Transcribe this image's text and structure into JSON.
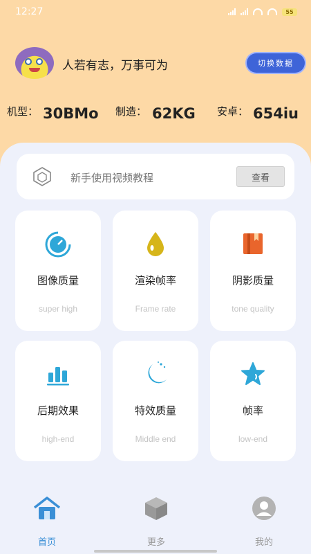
{
  "status_bar": {
    "time": "12:27",
    "battery": "55",
    "icons": [
      "signal-icon",
      "signal-icon",
      "wifi-icon",
      "wifi-icon",
      "battery-icon"
    ]
  },
  "header": {
    "avatar_icon": "spongebob-avatar",
    "motto": "人若有志，万事可为",
    "switch_label": "切换数据"
  },
  "specs": [
    {
      "label": "机型：",
      "value": "30BMo"
    },
    {
      "label": "制造：",
      "value": "62KG"
    },
    {
      "label": "安卓：",
      "value": "654iu"
    }
  ],
  "tutorial": {
    "icon": "hexagon-cube-icon",
    "text": "新手使用视频教程",
    "button": "查看"
  },
  "features": [
    {
      "title": "图像质量",
      "subtitle": "super high",
      "icon": "gauge-icon",
      "color": "#2ea7d8"
    },
    {
      "title": "渲染帧率",
      "subtitle": "Frame rate",
      "icon": "drop-icon",
      "color": "#d6b51a"
    },
    {
      "title": "阴影质量",
      "subtitle": "tone quality",
      "icon": "book-icon",
      "color": "#e9652c"
    },
    {
      "title": "后期效果",
      "subtitle": "high-end",
      "icon": "bar-chart-icon",
      "color": "#2ea7d8"
    },
    {
      "title": "特效质量",
      "subtitle": "Middle end",
      "icon": "moon-stars-icon",
      "color": "#2ea7d8"
    },
    {
      "title": "帧率",
      "subtitle": "low-end",
      "icon": "star-icon",
      "color": "#2ea7d8"
    }
  ],
  "bottom_nav": [
    {
      "label": "首页",
      "icon": "home-icon",
      "active": true
    },
    {
      "label": "更多",
      "icon": "cube-icon",
      "active": false
    },
    {
      "label": "我的",
      "icon": "user-icon",
      "active": false
    }
  ],
  "colors": {
    "header_bg": "#fdd9a6",
    "panel_bg": "#eef1fb",
    "accent_blue": "#3e64d8",
    "nav_active": "#3a8fd6",
    "nav_inactive": "#999999"
  }
}
